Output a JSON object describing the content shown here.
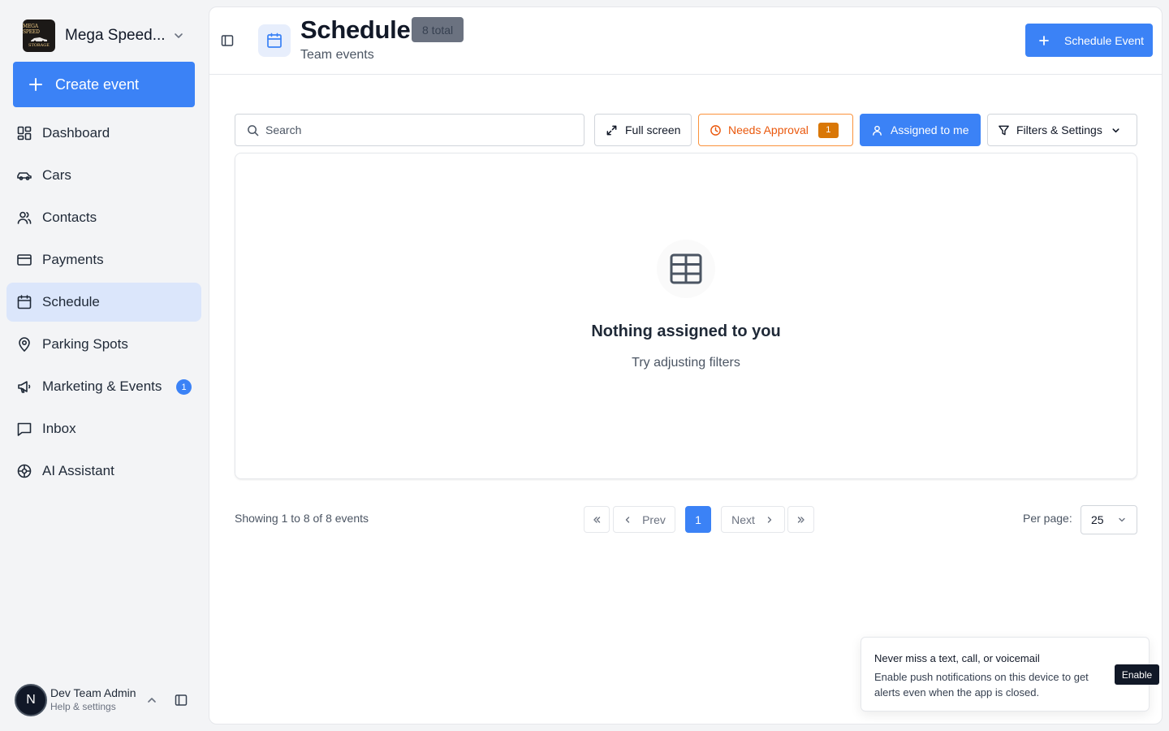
{
  "sidebar": {
    "org_name": "Mega Speed...",
    "logo_text_top": "MEGA SPEED",
    "logo_text_bottom": "STORAGE",
    "create_label": "Create event",
    "items": [
      {
        "label": "Dashboard",
        "icon": "dashboard-icon"
      },
      {
        "label": "Cars",
        "icon": "car-icon"
      },
      {
        "label": "Contacts",
        "icon": "users-icon"
      },
      {
        "label": "Payments",
        "icon": "credit-card-icon"
      },
      {
        "label": "Schedule",
        "icon": "calendar-icon",
        "active": true
      },
      {
        "label": "Parking Spots",
        "icon": "map-pin-icon"
      },
      {
        "label": "Marketing & Events",
        "icon": "megaphone-icon",
        "badge": "1"
      },
      {
        "label": "Inbox",
        "icon": "message-square-icon"
      },
      {
        "label": "AI Assistant",
        "icon": "ai-icon"
      }
    ],
    "user": {
      "initial": "N",
      "name": "Dev Team Admin",
      "subtitle": "Help & settings"
    }
  },
  "header": {
    "title": "Schedule",
    "total_badge": "8 total",
    "subtitle": "Team events",
    "schedule_button": "Schedule Event"
  },
  "toolbar": {
    "search_placeholder": "Search",
    "fullscreen_label": "Full screen",
    "approval_label": "Needs Approval",
    "approval_count": "1",
    "assigned_label": "Assigned to me",
    "filters_label": "Filters & Settings"
  },
  "empty": {
    "title": "Nothing assigned to you",
    "subtitle": "Try adjusting filters"
  },
  "pagination": {
    "showing": "Showing 1 to 8 of 8 events",
    "prev_label": "Prev",
    "current_page": "1",
    "next_label": "Next",
    "per_page_label": "Per page:",
    "per_page_value": "25"
  },
  "toast": {
    "title": "Never miss a text, call, or voicemail",
    "body": "Enable push notifications on this device to get alerts even when the app is closed.",
    "button": "Enable"
  },
  "colors": {
    "accent": "#3b82f6",
    "active_nav_bg": "#dbe6fb",
    "approval": "#ea580c",
    "approval_badge": "#d97706"
  }
}
